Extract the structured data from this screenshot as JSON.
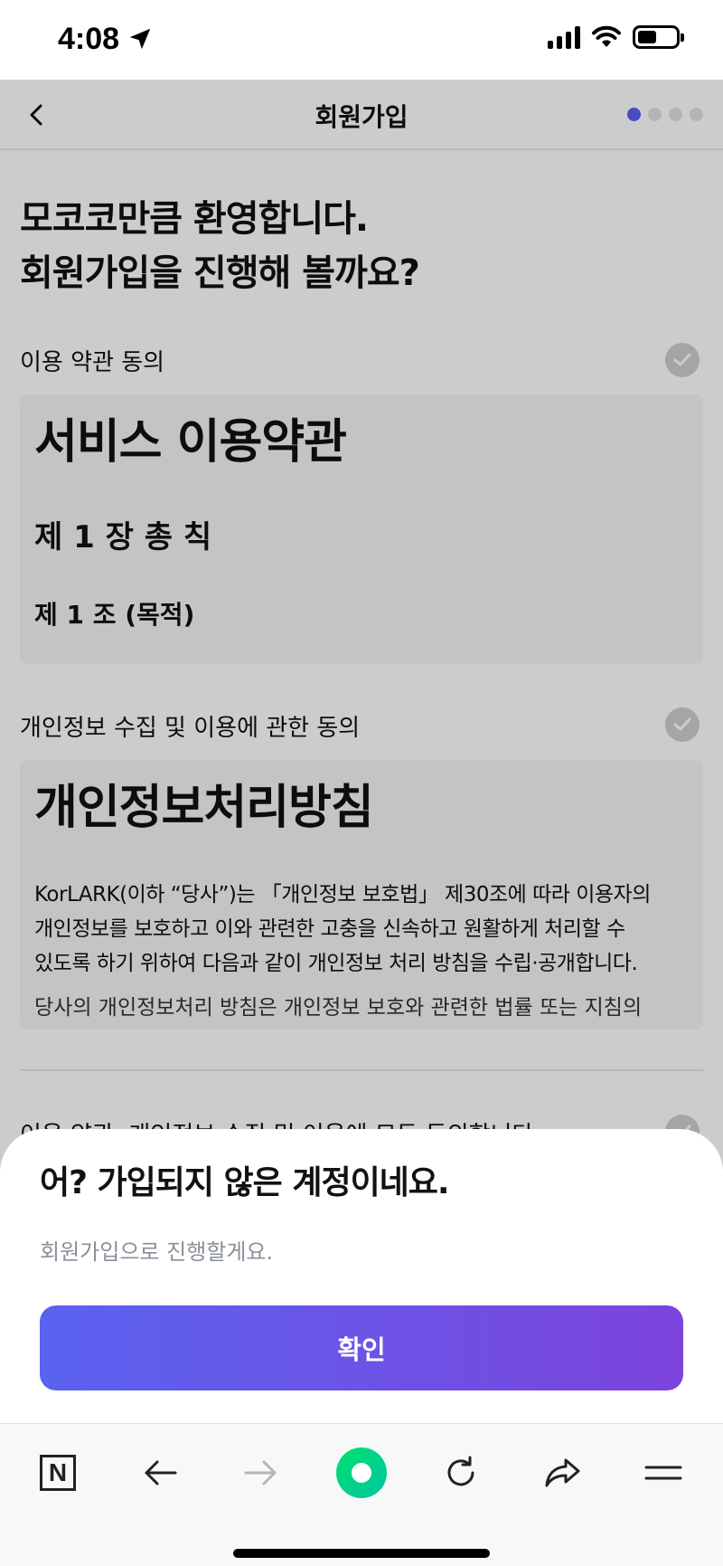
{
  "status_bar": {
    "time": "4:08"
  },
  "nav": {
    "title": "회원가입",
    "step_current": 1,
    "step_total": 4
  },
  "headline": {
    "line1": "모코코만큼 환영합니다.",
    "line2": "회원가입을 진행해 볼까요?"
  },
  "terms": {
    "label": "이용 약관 동의",
    "title": "서비스 이용약관",
    "chapter": "제 1 장 총 칙",
    "article": "제 1 조 (목적)"
  },
  "privacy": {
    "label": "개인정보 수집 및 이용에 관한 동의",
    "title": "개인정보처리방침",
    "para1_line1": "KorLARK(이하 “당사”)는 「개인정보 보호법」 제30조에 따라 이용자의",
    "para1_line2": "개인정보를 보호하고 이와 관련한 고충을 신속하고 원활하게 처리할 수",
    "para1_line3": "있도록 하기 위하여 다음과 같이 개인정보 처리 방침을 수립·공개합니다.",
    "para2": "당사의 개인정보처리 방침은 개인정보 보호와 관련한 법률 또는 지침의"
  },
  "all_agree": {
    "label": "이용 약관, 개인정보 수집 및 이용에 모두 동의합니다."
  },
  "sheet": {
    "title": "어? 가입되지 않은 계정이네요.",
    "subtitle": "회원가입으로 진행할게요.",
    "confirm_label": "확인"
  },
  "toolbar": {
    "icons": [
      "naver-home-icon",
      "back-arrow-icon",
      "forward-arrow-icon",
      "green-dot-icon",
      "refresh-icon",
      "share-icon",
      "menu-icon"
    ]
  },
  "colors": {
    "accent_start": "#5a63f0",
    "accent_end": "#7c44dc",
    "step_active": "#5b5ff0"
  }
}
